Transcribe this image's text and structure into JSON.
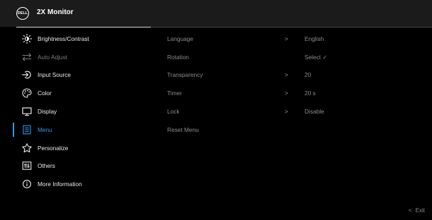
{
  "header": {
    "logo_text": "DELL",
    "title": "2X Monitor"
  },
  "menu": [
    {
      "label": "Brightness/Contrast",
      "icon": "brightness-icon",
      "state": "normal"
    },
    {
      "label": "Auto Adjust",
      "icon": "auto-adjust-icon",
      "state": "disabled"
    },
    {
      "label": "Input Source",
      "icon": "input-source-icon",
      "state": "normal"
    },
    {
      "label": "Color",
      "icon": "color-palette-icon",
      "state": "normal"
    },
    {
      "label": "Display",
      "icon": "display-icon",
      "state": "normal"
    },
    {
      "label": "Menu",
      "icon": "menu-icon",
      "state": "selected"
    },
    {
      "label": "Personalize",
      "icon": "star-icon",
      "state": "normal"
    },
    {
      "label": "Others",
      "icon": "others-icon",
      "state": "normal"
    },
    {
      "label": "More Information",
      "icon": "info-icon",
      "state": "normal"
    }
  ],
  "submenu": [
    {
      "name": "Language",
      "chevron": ">",
      "value": "English"
    },
    {
      "name": "Rotation",
      "chevron": "",
      "value": "Select ✓"
    },
    {
      "name": "Transparency",
      "chevron": ">",
      "value": "20"
    },
    {
      "name": "Timer",
      "chevron": ">",
      "value": "20 s"
    },
    {
      "name": "Lock",
      "chevron": ">",
      "value": "Disable"
    },
    {
      "name": "Reset Menu",
      "chevron": "",
      "value": ""
    }
  ],
  "footer": {
    "exit_chevron": "<",
    "exit_label": "Exit"
  },
  "colors": {
    "background": "#000000",
    "header_bg": "#1b1b1b",
    "accent": "#2f9ae8",
    "text": "#eaeaea",
    "dim_text": "#8c8c8c",
    "disabled_text": "#7d7d7d"
  }
}
